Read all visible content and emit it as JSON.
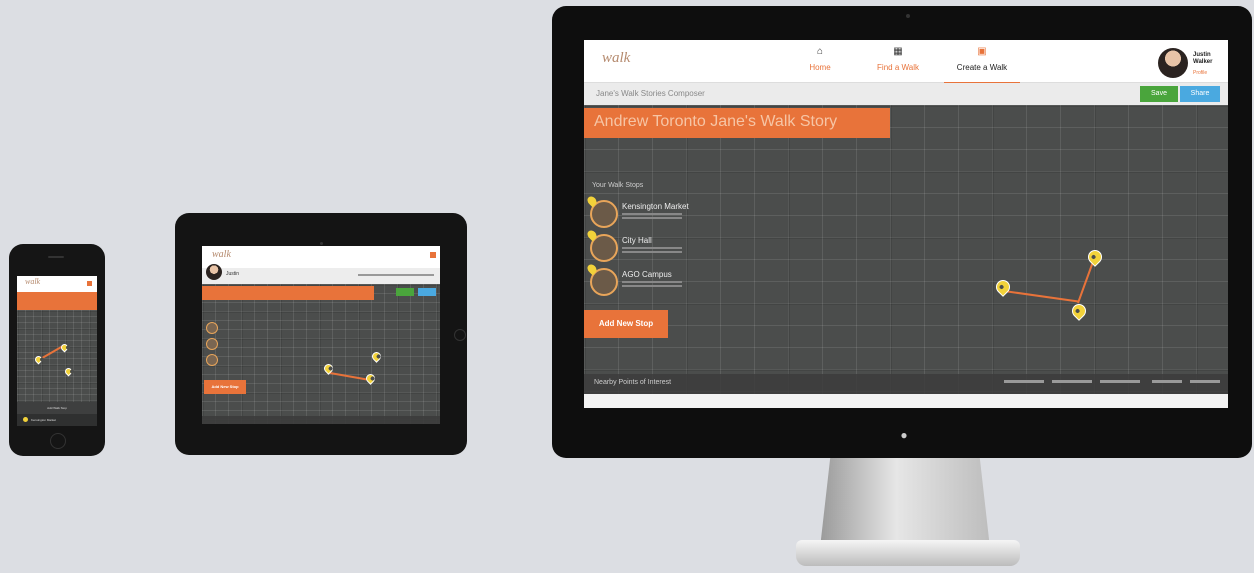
{
  "colors": {
    "accent": "#e8733a",
    "save": "#4aa53c",
    "share": "#4aa9e0",
    "map": "#4b4d4c",
    "pin": "#f2d23a"
  },
  "desktop": {
    "logo": "walk",
    "nav": [
      {
        "label": "Home",
        "icon": "home-icon"
      },
      {
        "label": "Find a Walk",
        "icon": "calendar-icon"
      },
      {
        "label": "Create a Walk",
        "icon": "create-icon"
      }
    ],
    "user": {
      "name_line1": "Justin",
      "name_line2": "Walker",
      "sub": "Profile"
    },
    "breadcrumb": "Jane's Walk Stories Composer",
    "save_label": "Save",
    "share_label": "Share",
    "banner_title": "Andrew Toronto Jane's Walk Story",
    "stops_heading": "Your Walk Stops",
    "stops": [
      {
        "name": "Kensington Market"
      },
      {
        "name": "City Hall"
      },
      {
        "name": "AGO Campus"
      }
    ],
    "add_stop_label": "Add New Stop",
    "footer_title": "Nearby Points of Interest"
  },
  "tablet": {
    "user_name": "Justin",
    "add_stop_label": "Add New Stop"
  },
  "phone": {
    "list_label": "Add Walk Stop",
    "list_item": "Kensington Market"
  }
}
